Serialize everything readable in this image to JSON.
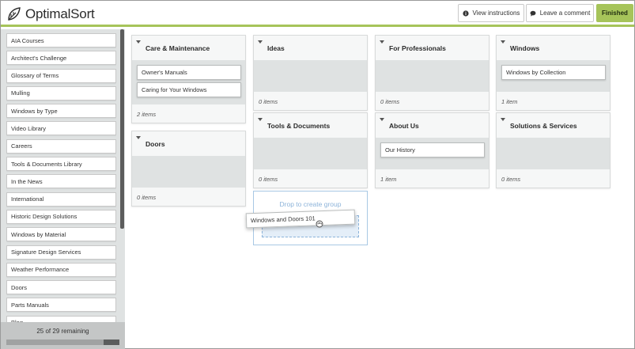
{
  "header": {
    "app_name": "OptimalSort",
    "view_instructions": "View instructions",
    "leave_comment": "Leave a comment",
    "finished": "Finished"
  },
  "sidebar": {
    "cards": [
      "AIA Courses",
      "Architect's Challenge",
      "Glossary of Terms",
      "Mulling",
      "Windows by Type",
      "Video Library",
      "Careers",
      "Tools & Documents Library",
      "In the News",
      "International",
      "Historic Design Solutions",
      "Windows by Material",
      "Signature Design Services",
      "Weather Performance",
      "Doors",
      "Parts Manuals",
      "Blog"
    ],
    "remaining": "25 of 29 remaining",
    "progress_remaining_fraction": 0.14
  },
  "groups": [
    {
      "title": "Care & Maintenance",
      "cards": [
        "Owner's Manuals",
        "Caring for Your Windows"
      ],
      "count": "2 items"
    },
    {
      "title": "Ideas",
      "cards": [],
      "count": "0 items"
    },
    {
      "title": "For Professionals",
      "cards": [],
      "count": "0 items"
    },
    {
      "title": "Windows",
      "cards": [
        "Windows by Collection"
      ],
      "count": "1 item"
    },
    {
      "title": "Doors",
      "cards": [],
      "count": "0 items"
    },
    {
      "title": "Tools & Documents",
      "cards": [],
      "count": "0 items"
    },
    {
      "title": "About Us",
      "cards": [
        "Our History"
      ],
      "count": "1 item"
    },
    {
      "title": "Solutions & Services",
      "cards": [],
      "count": "0 items"
    }
  ],
  "dropzone": {
    "label": "Drop to create group"
  },
  "dragging_card": "Windows and Doors 101",
  "colors": {
    "accent": "#a6c45a",
    "drop": "#8cb3d9"
  }
}
